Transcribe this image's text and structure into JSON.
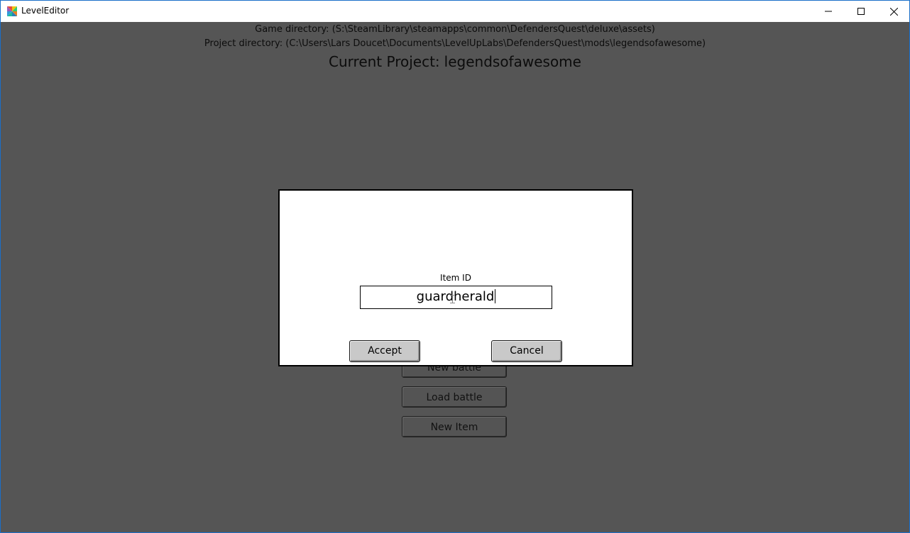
{
  "window": {
    "title": "LevelEditor",
    "accent_color": "#1a6fc9"
  },
  "header": {
    "game_directory": "Game directory: (S:\\SteamLibrary\\steamapps\\common\\DefendersQuest\\deluxe\\assets)",
    "project_directory": "Project directory: (C:\\Users\\Lars Doucet\\Documents\\LevelUpLabs\\DefendersQuest\\mods\\legendsofawesome)",
    "current_project_label": "Current Project:",
    "current_project_name": "legendsofawesome"
  },
  "menu": {
    "new_battle": "New battle",
    "load_battle": "Load battle",
    "new_item": "New Item"
  },
  "dialog": {
    "field_label": "Item ID",
    "field_value": "guardherald",
    "accept_label": "Accept",
    "cancel_label": "Cancel"
  },
  "colors": {
    "background": "#555555",
    "dialog": "#ffffff",
    "button": "#c9c9c9"
  }
}
